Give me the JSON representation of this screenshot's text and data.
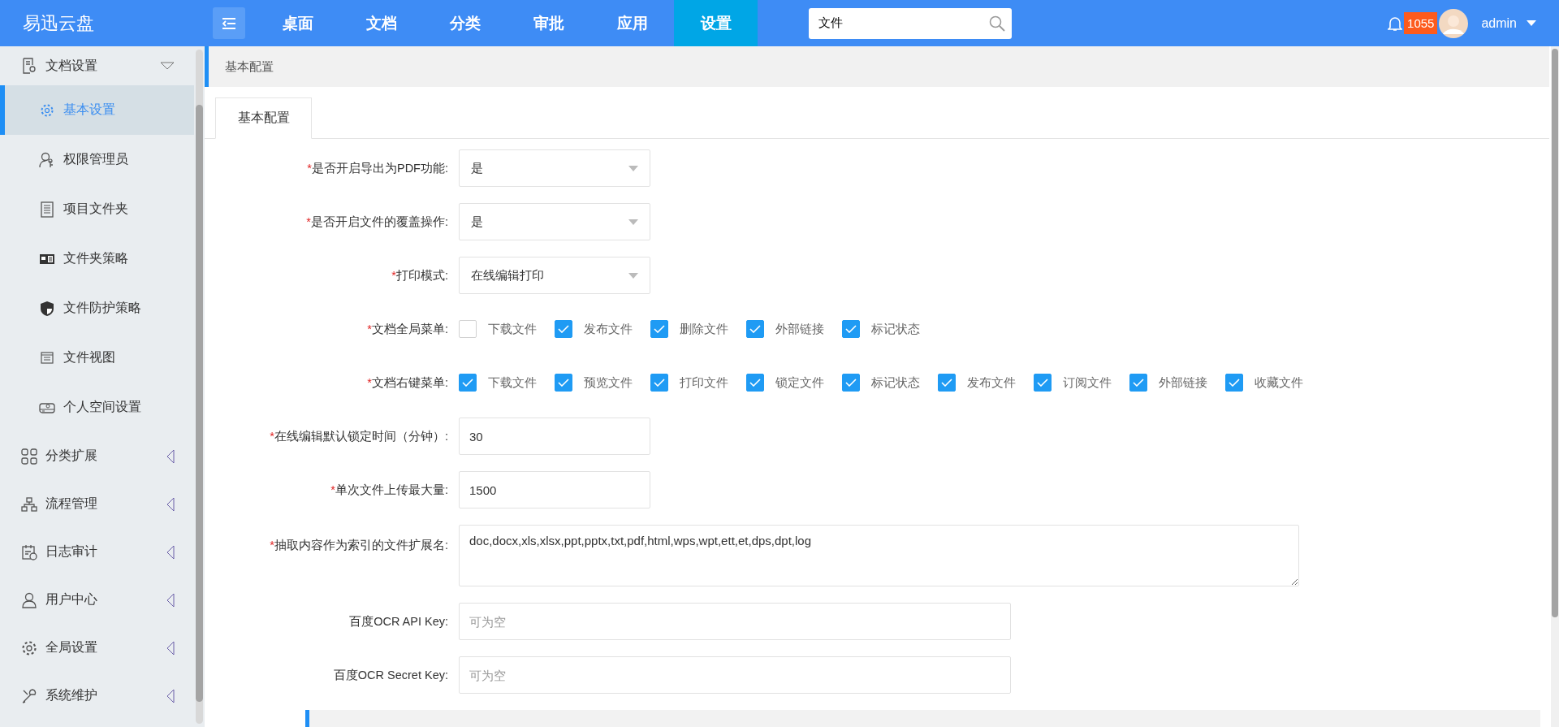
{
  "header": {
    "logo": "易迅云盘",
    "nav": [
      {
        "label": "桌面",
        "selected": false
      },
      {
        "label": "文档",
        "selected": false
      },
      {
        "label": "分类",
        "selected": false
      },
      {
        "label": "审批",
        "selected": false
      },
      {
        "label": "应用",
        "selected": false
      },
      {
        "label": "设置",
        "selected": true
      }
    ],
    "search": {
      "value": "文件"
    },
    "notification_count": "1055",
    "user": "admin"
  },
  "sidebar": {
    "groups": [
      {
        "label": "文档设置",
        "expanded": true,
        "children": [
          {
            "label": "基本设置",
            "selected": true
          },
          {
            "label": "权限管理员",
            "selected": false
          },
          {
            "label": "项目文件夹",
            "selected": false
          },
          {
            "label": "文件夹策略",
            "selected": false
          },
          {
            "label": "文件防护策略",
            "selected": false
          },
          {
            "label": "文件视图",
            "selected": false
          },
          {
            "label": "个人空间设置",
            "selected": false
          }
        ]
      },
      {
        "label": "分类扩展",
        "expanded": false
      },
      {
        "label": "流程管理",
        "expanded": false
      },
      {
        "label": "日志审计",
        "expanded": false
      },
      {
        "label": "用户中心",
        "expanded": false
      },
      {
        "label": "全局设置",
        "expanded": false
      },
      {
        "label": "系统维护",
        "expanded": false
      }
    ]
  },
  "breadcrumb": "基本配置",
  "tabs": [
    {
      "label": "基本配置",
      "selected": true
    }
  ],
  "form": [
    {
      "kind": "select",
      "required_mark": "*",
      "label": "是否开启导出为PDF功能:",
      "value": "是"
    },
    {
      "kind": "select",
      "required_mark": "*",
      "label": "是否开启文件的覆盖操作:",
      "value": "是"
    },
    {
      "kind": "select",
      "required_mark": "*",
      "label": "打印模式:",
      "value": "在线编辑打印"
    },
    {
      "kind": "checkboxes",
      "required_mark": "*",
      "label": "文档全局菜单:",
      "options": [
        {
          "label": "下载文件",
          "checked": false
        },
        {
          "label": "发布文件",
          "checked": true
        },
        {
          "label": "删除文件",
          "checked": true
        },
        {
          "label": "外部链接",
          "checked": true
        },
        {
          "label": "标记状态",
          "checked": true
        }
      ]
    },
    {
      "kind": "checkboxes",
      "required_mark": "*",
      "label": "文档右键菜单:",
      "options": [
        {
          "label": "下载文件",
          "checked": true
        },
        {
          "label": "预览文件",
          "checked": true
        },
        {
          "label": "打印文件",
          "checked": true
        },
        {
          "label": "锁定文件",
          "checked": true
        },
        {
          "label": "标记状态",
          "checked": true
        },
        {
          "label": "发布文件",
          "checked": true
        },
        {
          "label": "订阅文件",
          "checked": true
        },
        {
          "label": "外部链接",
          "checked": true
        },
        {
          "label": "收藏文件",
          "checked": true
        }
      ]
    },
    {
      "kind": "input",
      "required_mark": "*",
      "label": "在线编辑默认锁定时间（分钟）:",
      "value": "30"
    },
    {
      "kind": "input",
      "required_mark": "*",
      "label": "单次文件上传最大量:",
      "value": "1500"
    },
    {
      "kind": "textarea",
      "required_mark": "*",
      "label": "抽取内容作为索引的文件扩展名:",
      "value": "doc,docx,xls,xlsx,ppt,pptx,txt,pdf,html,wps,wpt,ett,et,dps,dpt,log"
    },
    {
      "kind": "input_wide",
      "label": "百度OCR API Key:",
      "placeholder": "可为空"
    },
    {
      "kind": "input_wide",
      "label": "百度OCR Secret Key:",
      "placeholder": "可为空"
    }
  ]
}
